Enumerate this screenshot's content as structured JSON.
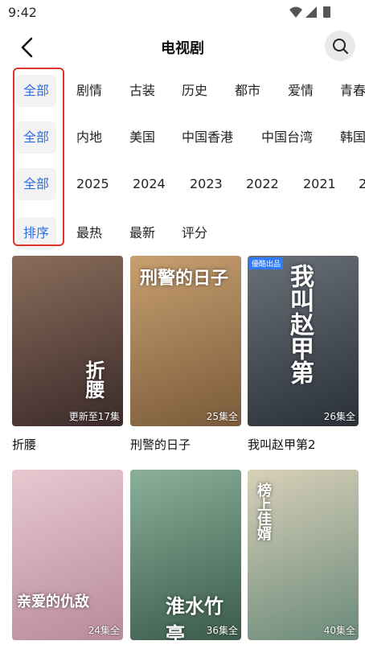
{
  "status": {
    "time": "9:42"
  },
  "header": {
    "title": "电视剧"
  },
  "filters": {
    "genre": {
      "active": "全部",
      "options": [
        "剧情",
        "古装",
        "历史",
        "都市",
        "爱情",
        "青春"
      ]
    },
    "region": {
      "active": "全部",
      "options": [
        "内地",
        "美国",
        "中国香港",
        "中国台湾",
        "韩国"
      ]
    },
    "year": {
      "active": "全部",
      "options": [
        "2025",
        "2024",
        "2023",
        "2022",
        "2021",
        "2"
      ]
    },
    "sort": {
      "active": "排序",
      "options": [
        "最热",
        "最新",
        "评分"
      ]
    }
  },
  "dramas": [
    {
      "title": "折腰",
      "status": "更新至17集",
      "poster_text": "折腰",
      "colors": [
        "#3a2a2a",
        "#8a6d5a"
      ]
    },
    {
      "title": "刑警的日子",
      "status": "25集全",
      "poster_text": "刑警的日子",
      "colors": [
        "#7a5a3a",
        "#c8a070"
      ]
    },
    {
      "title": "我叫赵甲第2",
      "status": "26集全",
      "poster_text": "我叫赵甲第",
      "tag": "優酷出品",
      "colors": [
        "#2a3038",
        "#6a7078"
      ]
    },
    {
      "title": "",
      "status": "24集全",
      "poster_text": "亲爱的仇敌",
      "colors": [
        "#b88a9a",
        "#e8c8d0"
      ]
    },
    {
      "title": "",
      "status": "36集全",
      "poster_text": "淮水竹亭",
      "colors": [
        "#3a5a4a",
        "#8ab09a"
      ]
    },
    {
      "title": "",
      "status": "40集全",
      "poster_text": "榜上佳婿",
      "colors": [
        "#6a8a7a",
        "#d8d0b8"
      ]
    }
  ]
}
